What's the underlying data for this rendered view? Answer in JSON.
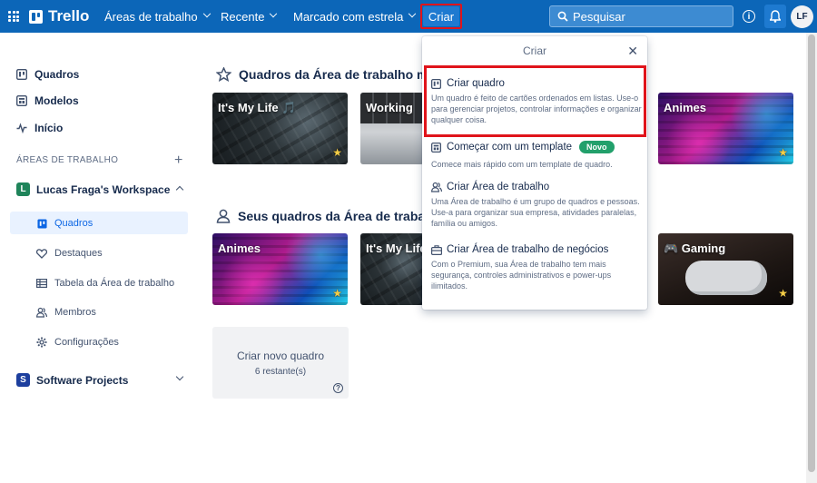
{
  "app": {
    "name": "Trello"
  },
  "nav": {
    "workspaces": "Áreas de trabalho",
    "recent": "Recente",
    "starred": "Marcado com estrela",
    "create": "Criar",
    "search_placeholder": "Pesquisar",
    "avatar_initials": "LF"
  },
  "sidebar": {
    "items": [
      {
        "label": "Quadros",
        "icon": "board-icon"
      },
      {
        "label": "Modelos",
        "icon": "template-icon"
      },
      {
        "label": "Início",
        "icon": "activity-icon"
      }
    ],
    "section_label": "ÁREAS DE TRABALHO",
    "workspace1": {
      "badge": "L",
      "name": "Lucas Fraga's Workspace",
      "color": "#1f845a"
    },
    "subitems": [
      {
        "label": "Quadros",
        "icon": "board-icon",
        "active": true
      },
      {
        "label": "Destaques",
        "icon": "heart-icon"
      },
      {
        "label": "Tabela da Área de trabalho",
        "icon": "table-icon"
      },
      {
        "label": "Membros",
        "icon": "members-icon"
      },
      {
        "label": "Configurações",
        "icon": "gear-icon"
      }
    ],
    "workspace2": {
      "badge": "S",
      "name": "Software Projects",
      "color": "#1d3f9e"
    }
  },
  "main": {
    "starred_title": "Quadros da Área de trabalho ma",
    "starred_boards": [
      {
        "title": "It's My Life 🎵",
        "starred": true
      },
      {
        "title": "Working",
        "starred": false
      },
      {
        "title": "Animes",
        "starred": true
      }
    ],
    "workspace_title": "Seus quadros da Área de trabalh",
    "workspace_boards": [
      {
        "title": "Animes",
        "starred": true
      },
      {
        "title": "It's My Life",
        "starred": false
      },
      {
        "title": "🎮 Gaming",
        "starred": true
      }
    ],
    "create_tile": {
      "label": "Criar novo quadro",
      "remaining": "6 restante(s)"
    }
  },
  "popover": {
    "title": "Criar",
    "options": [
      {
        "title": "Criar quadro",
        "icon": "board-icon",
        "desc": "Um quadro é feito de cartões ordenados em listas. Use-o para gerenciar projetos, controlar informações e organizar qualquer coisa."
      },
      {
        "title": "Começar com um template",
        "icon": "template-icon",
        "badge": "Novo",
        "desc": "Comece mais rápido com um template de quadro."
      },
      {
        "title": "Criar Área de trabalho",
        "icon": "members-icon",
        "desc": "Uma Área de trabalho é um grupo de quadros e pessoas. Use-a para organizar sua empresa, atividades paralelas, família ou amigos."
      },
      {
        "title": "Criar Área de trabalho de negócios",
        "icon": "briefcase-icon",
        "desc": "Com o Premium, sua Área de trabalho tem mais segurança, controles administrativos e power-ups ilimitados."
      }
    ]
  }
}
